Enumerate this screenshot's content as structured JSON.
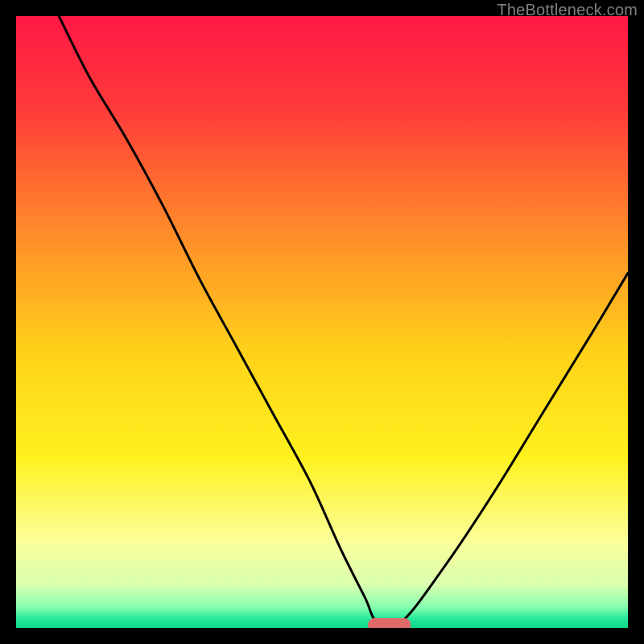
{
  "watermark": "TheBottleneck.com",
  "chart_data": {
    "type": "line",
    "title": "",
    "xlabel": "",
    "ylabel": "",
    "xlim": [
      0,
      100
    ],
    "ylim": [
      0,
      100
    ],
    "grid": false,
    "legend": false,
    "gradient_stops": [
      {
        "offset": 0.0,
        "color": "#ff1846"
      },
      {
        "offset": 0.15,
        "color": "#ff3a3a"
      },
      {
        "offset": 0.35,
        "color": "#ff8a2a"
      },
      {
        "offset": 0.55,
        "color": "#ffd21a"
      },
      {
        "offset": 0.72,
        "color": "#fff11e"
      },
      {
        "offset": 0.86,
        "color": "#fbff9a"
      },
      {
        "offset": 0.93,
        "color": "#d8ffb0"
      },
      {
        "offset": 0.965,
        "color": "#8affb0"
      },
      {
        "offset": 0.985,
        "color": "#25e89a"
      },
      {
        "offset": 1.0,
        "color": "#0fd98a"
      }
    ],
    "series": [
      {
        "name": "bottleneck-curve",
        "x": [
          7,
          12,
          18,
          24,
          30,
          36,
          42,
          48,
          53,
          57,
          59,
          63,
          70,
          78,
          86,
          94,
          100
        ],
        "y": [
          100,
          90,
          80,
          69,
          57,
          46,
          35,
          24,
          13,
          5,
          1,
          1,
          10,
          22,
          35,
          48,
          58
        ]
      }
    ],
    "marker": {
      "name": "optimum-marker",
      "color": "#e06a6a",
      "x_center": 61,
      "y": 0.5,
      "width": 7,
      "height": 2.2,
      "rx": 1.1
    }
  }
}
